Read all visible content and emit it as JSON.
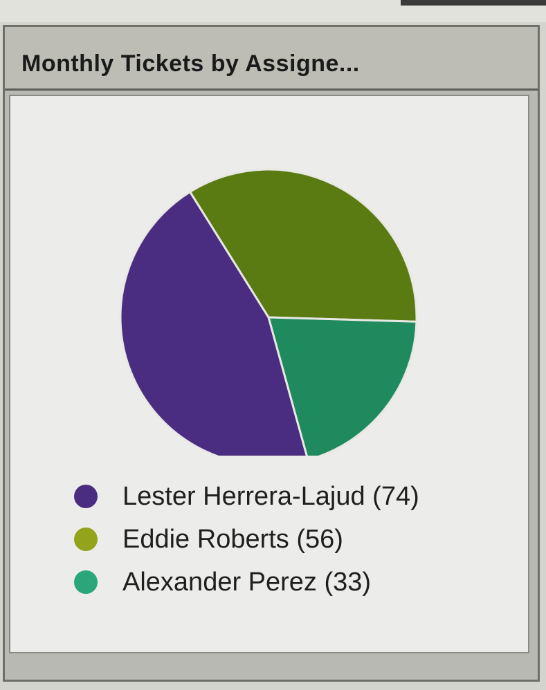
{
  "widget": {
    "title": "Monthly Tickets by Assigne..."
  },
  "colors": {
    "lester": "#4a2d80",
    "eddie": "#5a7a12",
    "alexander": "#1f8a5e"
  },
  "legend": [
    {
      "label": "Lester Herrera-Lajud (74)",
      "color": "#4a2d80"
    },
    {
      "label": "Eddie Roberts (56)",
      "color": "#93a31a"
    },
    {
      "label": "Alexander Perez (33)",
      "color": "#2aa67a"
    }
  ],
  "chart_data": {
    "type": "pie",
    "title": "Monthly Tickets by Assigne...",
    "series": [
      {
        "name": "",
        "categories": [
          "Lester Herrera-Lajud",
          "Eddie Roberts",
          "Alexander Perez"
        ],
        "values": [
          74,
          56,
          33
        ],
        "colors": [
          "#4a2d80",
          "#5a7a12",
          "#1f8a5e"
        ]
      }
    ],
    "legend_position": "bottom"
  }
}
